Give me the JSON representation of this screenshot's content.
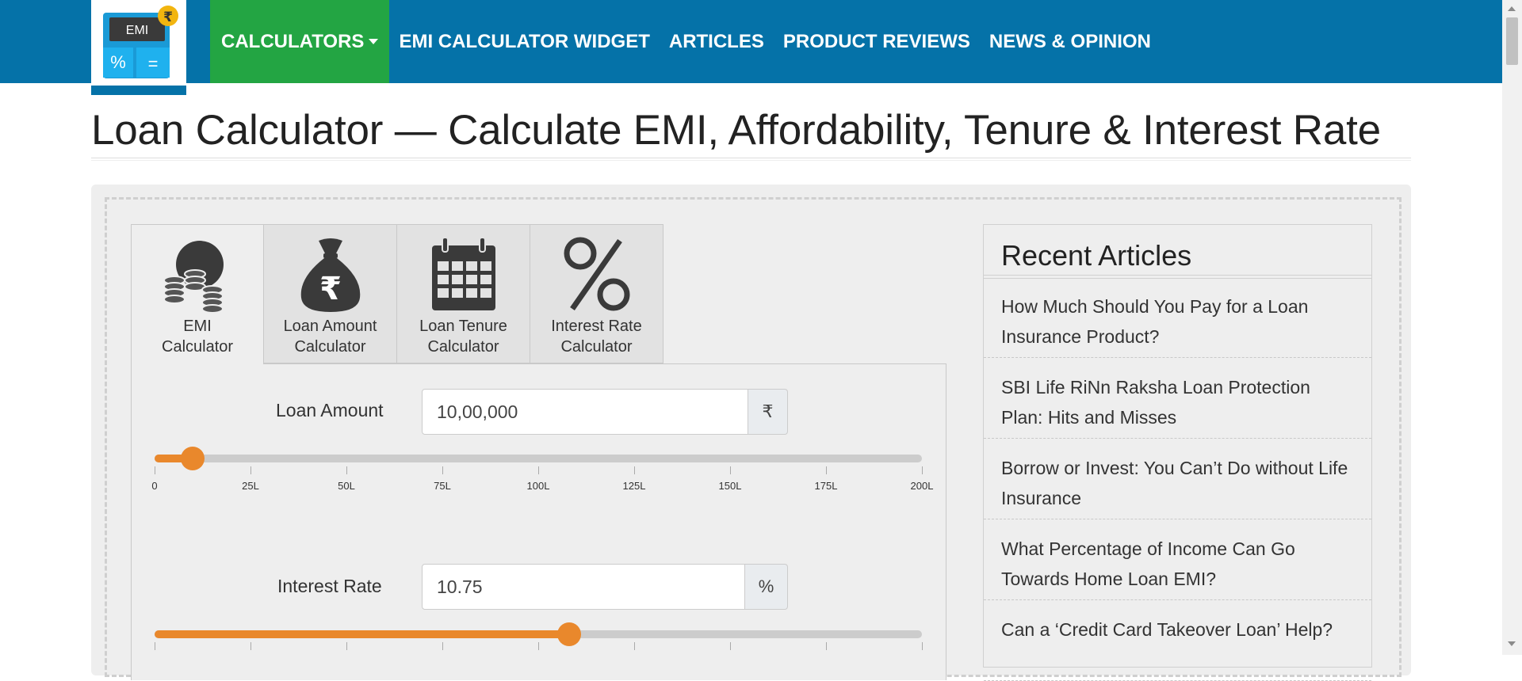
{
  "nav": {
    "logo": {
      "screen_text": "EMI",
      "rupee": "₹",
      "percent": "%",
      "equals": "="
    },
    "items": [
      {
        "label": "CALCULATORS",
        "active": true,
        "dropdown": true
      },
      {
        "label": "EMI CALCULATOR WIDGET"
      },
      {
        "label": "ARTICLES"
      },
      {
        "label": "PRODUCT REVIEWS"
      },
      {
        "label": "NEWS & OPINION"
      }
    ]
  },
  "page": {
    "title": "Loan Calculator — Calculate EMI, Affordability, Tenure & Interest Rate"
  },
  "tabs": [
    {
      "label": "EMI Calculator",
      "icon": "coins-icon",
      "active": true
    },
    {
      "label": "Loan Amount Calculator",
      "icon": "money-bag-icon"
    },
    {
      "label": "Loan Tenure Calculator",
      "icon": "calendar-icon"
    },
    {
      "label": "Interest Rate Calculator",
      "icon": "percent-icon"
    }
  ],
  "form": {
    "loan_amount": {
      "label": "Loan Amount",
      "value": "10,00,000",
      "unit": "₹",
      "slider": {
        "value_lakh": 10,
        "max_lakh": 200,
        "ticks": [
          "0",
          "25L",
          "50L",
          "75L",
          "100L",
          "125L",
          "150L",
          "175L",
          "200L"
        ]
      }
    },
    "interest_rate": {
      "label": "Interest Rate",
      "value": "10.75",
      "unit": "%",
      "slider": {
        "fraction": 0.54
      }
    }
  },
  "sidebar": {
    "title": "Recent Articles",
    "articles": [
      {
        "title": "How Much Should You Pay for a Loan Insurance Product?"
      },
      {
        "title": "SBI Life RiNn Raksha Loan Protection Plan: Hits and Misses"
      },
      {
        "title": "Borrow or Invest: You Can’t Do without Life Insurance"
      },
      {
        "title": "What Percentage of Income Can Go Towards Home Loan EMI?"
      },
      {
        "title": "Can a ‘Credit Card Takeover Loan’ Help?"
      }
    ]
  },
  "colors": {
    "nav_bg": "#0572a8",
    "nav_active": "#23a543",
    "accent": "#e9882c"
  }
}
